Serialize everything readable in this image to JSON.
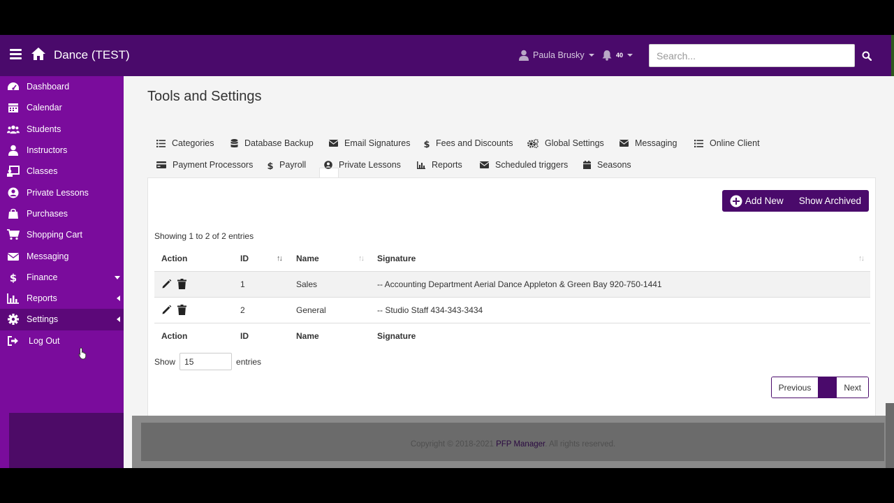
{
  "app": {
    "title": "Dance (TEST)",
    "user_name": "Paula Brusky",
    "notification_count": "40",
    "search_placeholder": "Search..."
  },
  "sidebar": {
    "items": [
      {
        "label": "Dashboard",
        "icon": "dashboard-icon"
      },
      {
        "label": "Calendar",
        "icon": "calendar-icon"
      },
      {
        "label": "Students",
        "icon": "users-icon"
      },
      {
        "label": "Instructors",
        "icon": "user-icon"
      },
      {
        "label": "Classes",
        "icon": "chalkboard-icon"
      },
      {
        "label": "Private Lessons",
        "icon": "user-circle-icon"
      },
      {
        "label": "Purchases",
        "icon": "shopping-bag-icon"
      },
      {
        "label": "Shopping Cart",
        "icon": "cart-icon"
      },
      {
        "label": "Messaging",
        "icon": "envelope-icon"
      },
      {
        "label": "Finance",
        "icon": "dollar-icon"
      },
      {
        "label": "Reports",
        "icon": "bar-chart-icon"
      },
      {
        "label": "Settings",
        "icon": "gear-icon"
      },
      {
        "label": "Log Out",
        "icon": "sign-out-icon"
      }
    ]
  },
  "main": {
    "page_title": "Tools and Settings",
    "tabs": [
      {
        "label": "Categories"
      },
      {
        "label": "Database Backup"
      },
      {
        "label": "Email Signatures"
      },
      {
        "label": "Fees and Discounts"
      },
      {
        "label": "Global Settings"
      },
      {
        "label": "Messaging"
      },
      {
        "label": "Online Client"
      },
      {
        "label": "Payment Processors"
      },
      {
        "label": "Payroll"
      },
      {
        "label": "Private Lessons"
      },
      {
        "label": "Reports"
      },
      {
        "label": "Scheduled triggers"
      },
      {
        "label": "Seasons"
      }
    ],
    "add_new_label": "Add New",
    "show_archived_label": "Show Archived",
    "showing_text": "Showing 1 to 2 of 2 entries",
    "columns": [
      "Action",
      "ID",
      "Name",
      "Signature"
    ],
    "rows": [
      {
        "id": "1",
        "name": "Sales",
        "signature": "-- Accounting Department Aerial Dance Appleton & Green Bay 920-750-1441"
      },
      {
        "id": "2",
        "name": "General",
        "signature": "-- Studio Staff 434-343-3434"
      }
    ],
    "show_label": "Show",
    "page_length": "15",
    "entries_label": "entries",
    "previous_label": "Previous",
    "next_label": "Next"
  },
  "footer": {
    "prefix": "Copyright © 2018-2021 ",
    "brand": "PFP Manager",
    "suffix": ". All rights reserved."
  },
  "colors": {
    "topbar": "#4a0a6b",
    "sidebar": "#7a0c9c",
    "accent": "#4a0a6b"
  }
}
